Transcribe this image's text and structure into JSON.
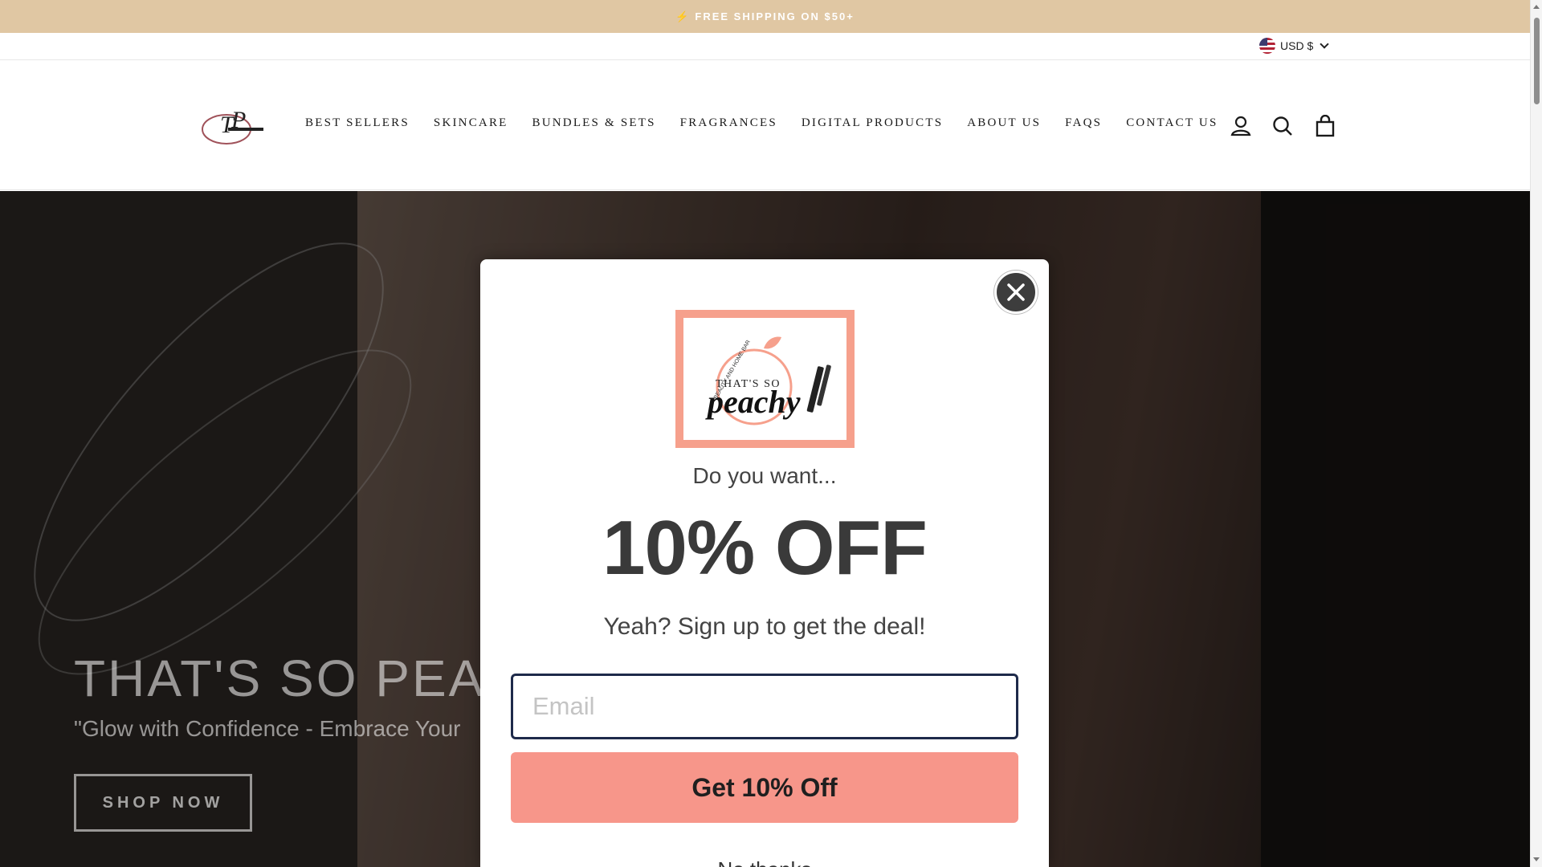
{
  "announcement": {
    "icon": "lightning-bolt-icon",
    "text": "FREE SHIPPING ON $50+"
  },
  "currency": {
    "label": "USD $",
    "flag": "us-flag-icon"
  },
  "header": {
    "logo_alt": "TP Beauty and Home Bar",
    "nav": [
      "BEST SELLERS",
      "SKINCARE",
      "BUNDLES & SETS",
      "FRAGRANCES",
      "DIGITAL PRODUCTS",
      "ABOUT US",
      "FAQS",
      "CONTACT US"
    ],
    "icons": [
      "account-icon",
      "search-icon",
      "cart-icon"
    ]
  },
  "hero": {
    "title": "THAT'S SO PEAC",
    "subtitle": "\"Glow with Confidence - Embrace Your",
    "button": "SHOP NOW"
  },
  "modal": {
    "brand_small": "BEAUTY AND HOME BAR",
    "brand_that": "THAT'S SO",
    "brand_peachy": "peachy",
    "question": "Do you want...",
    "headline": "10% OFF",
    "subline": "Yeah? Sign up to get the deal!",
    "email_placeholder": "Email",
    "submit_label": "Get 10% Off",
    "decline_label": "No thanks"
  },
  "colors": {
    "announcement_bg": "#e0c7a3",
    "modal_button": "#f7968a",
    "brand_frame": "#f6a08c",
    "email_border": "#1e2a4a"
  }
}
